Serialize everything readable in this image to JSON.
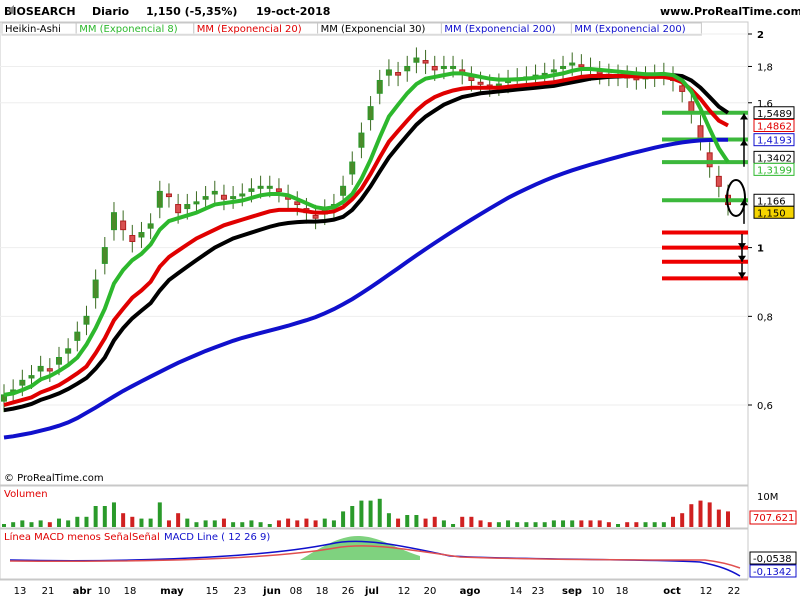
{
  "header": {
    "symbol": "BIOSEARCH",
    "period": "Diario",
    "quote": "1,150 (-5,35%)",
    "date": "19-oct-2018",
    "site": "www.ProRealTime.com"
  },
  "copyright": "© ProRealTime.com",
  "legend": [
    {
      "label": "Heikin-Ashi",
      "color": "#000000"
    },
    {
      "label": "MM (Exponencial 8)",
      "color": "#2db82d"
    },
    {
      "label": "MM (Exponencial 20)",
      "color": "#e00000"
    },
    {
      "label": "MM (Exponencial 30)",
      "color": "#000000"
    },
    {
      "label": "MM (Exponencial 200)",
      "color": "#1010cc"
    },
    {
      "label": "MM (Exponencial 200)",
      "color": "#1010cc"
    }
  ],
  "price_tags": [
    {
      "value": 1.5489,
      "text": "1,5489",
      "color": "#000000",
      "bg": "#ffffff"
    },
    {
      "value": 1.4862,
      "text": "1,4862",
      "color": "#e00000",
      "bg": "#ffffff"
    },
    {
      "value": 1.4193,
      "text": "1,4193",
      "color": "#1010cc",
      "bg": "#ffffff"
    },
    {
      "value": 1.3402,
      "text": "1,3402",
      "color": "#000000",
      "bg": "#ffffff"
    },
    {
      "value": 1.3199,
      "text": "1,3199",
      "color": "#2db82d",
      "bg": "#ffffff"
    },
    {
      "value": 1.166,
      "text": "1,166",
      "color": "#000000",
      "bg": "#ffffff"
    },
    {
      "value": 1.15,
      "text": "1,150",
      "color": "#000000",
      "bg": "#f5d400"
    }
  ],
  "volume": {
    "title": "Volumen",
    "axis_label": "10M",
    "value_tag": "707.621"
  },
  "macd": {
    "label1": "Línea MACD menos Señal",
    "label2": "Señal",
    "label3": "MACD Line ( 12 26 9)",
    "tag1": "-0,0538",
    "tag2": "-0,1342"
  },
  "chart_data": {
    "type": "candlestick",
    "scale": "log",
    "ylim": [
      0.54,
      2.08
    ],
    "y_ticks": [
      {
        "v": 2.0,
        "t": "2",
        "bold": true
      },
      {
        "v": 1.8,
        "t": "1,8",
        "bold": false
      },
      {
        "v": 1.6,
        "t": "1,6",
        "bold": false
      },
      {
        "v": 1.0,
        "t": "1",
        "bold": true
      },
      {
        "v": 0.8,
        "t": "0,8",
        "bold": false
      },
      {
        "v": 0.6,
        "t": "0,6",
        "bold": false
      }
    ],
    "x_ticks": [
      {
        "t": "13",
        "bold": false
      },
      {
        "t": "21",
        "bold": false
      },
      {
        "t": "abr",
        "bold": true
      },
      {
        "t": "10",
        "bold": false
      },
      {
        "t": "18",
        "bold": false
      },
      {
        "t": "may",
        "bold": true
      },
      {
        "t": "15",
        "bold": false
      },
      {
        "t": "23",
        "bold": false
      },
      {
        "t": "jun",
        "bold": true
      },
      {
        "t": "08",
        "bold": false
      },
      {
        "t": "18",
        "bold": false
      },
      {
        "t": "26",
        "bold": false
      },
      {
        "t": "jul",
        "bold": true
      },
      {
        "t": "12",
        "bold": false
      },
      {
        "t": "20",
        "bold": false
      },
      {
        "t": "ago",
        "bold": true
      },
      {
        "t": "14",
        "bold": false
      },
      {
        "t": "23",
        "bold": false
      },
      {
        "t": "sep",
        "bold": true
      },
      {
        "t": "10",
        "bold": false
      },
      {
        "t": "18",
        "bold": false
      },
      {
        "t": "oct",
        "bold": true
      },
      {
        "t": "12",
        "bold": false
      },
      {
        "t": "22",
        "bold": false
      }
    ],
    "close": [
      0.62,
      0.63,
      0.65,
      0.66,
      0.68,
      0.67,
      0.7,
      0.72,
      0.76,
      0.8,
      0.9,
      1.0,
      1.12,
      1.06,
      1.02,
      1.05,
      1.08,
      1.2,
      1.18,
      1.12,
      1.15,
      1.16,
      1.18,
      1.2,
      1.17,
      1.18,
      1.19,
      1.21,
      1.22,
      1.22,
      1.2,
      1.17,
      1.15,
      1.12,
      1.1,
      1.13,
      1.15,
      1.22,
      1.32,
      1.45,
      1.58,
      1.72,
      1.78,
      1.75,
      1.8,
      1.85,
      1.82,
      1.78,
      1.8,
      1.8,
      1.76,
      1.72,
      1.7,
      1.69,
      1.7,
      1.72,
      1.73,
      1.74,
      1.75,
      1.76,
      1.78,
      1.8,
      1.82,
      1.8,
      1.78,
      1.76,
      1.75,
      1.75,
      1.74,
      1.73,
      1.74,
      1.75,
      1.76,
      1.72,
      1.66,
      1.55,
      1.42,
      1.3,
      1.22,
      1.15
    ],
    "ema8": [
      0.62,
      0.623,
      0.63,
      0.638,
      0.652,
      0.659,
      0.67,
      0.683,
      0.7,
      0.73,
      0.77,
      0.82,
      0.89,
      0.93,
      0.96,
      0.98,
      1.01,
      1.06,
      1.09,
      1.1,
      1.11,
      1.12,
      1.135,
      1.15,
      1.155,
      1.16,
      1.165,
      1.175,
      1.185,
      1.19,
      1.19,
      1.185,
      1.17,
      1.155,
      1.14,
      1.135,
      1.14,
      1.16,
      1.19,
      1.25,
      1.33,
      1.43,
      1.53,
      1.59,
      1.65,
      1.7,
      1.73,
      1.74,
      1.75,
      1.76,
      1.76,
      1.75,
      1.74,
      1.73,
      1.725,
      1.725,
      1.727,
      1.73,
      1.735,
      1.74,
      1.75,
      1.76,
      1.775,
      1.785,
      1.785,
      1.78,
      1.775,
      1.77,
      1.765,
      1.76,
      1.755,
      1.755,
      1.757,
      1.75,
      1.72,
      1.66,
      1.57,
      1.47,
      1.38,
      1.32
    ],
    "ema20": [
      0.6,
      0.605,
      0.61,
      0.615,
      0.625,
      0.632,
      0.64,
      0.652,
      0.665,
      0.68,
      0.71,
      0.745,
      0.79,
      0.82,
      0.85,
      0.87,
      0.895,
      0.94,
      0.97,
      0.99,
      1.01,
      1.03,
      1.045,
      1.06,
      1.075,
      1.085,
      1.095,
      1.105,
      1.115,
      1.125,
      1.13,
      1.13,
      1.13,
      1.125,
      1.12,
      1.12,
      1.125,
      1.14,
      1.17,
      1.21,
      1.27,
      1.34,
      1.41,
      1.46,
      1.51,
      1.56,
      1.6,
      1.63,
      1.65,
      1.665,
      1.675,
      1.68,
      1.68,
      1.68,
      1.68,
      1.685,
      1.69,
      1.695,
      1.7,
      1.705,
      1.71,
      1.72,
      1.73,
      1.74,
      1.745,
      1.745,
      1.745,
      1.745,
      1.745,
      1.742,
      1.74,
      1.74,
      1.74,
      1.73,
      1.71,
      1.67,
      1.62,
      1.56,
      1.51,
      1.486
    ],
    "ema30": [
      0.59,
      0.593,
      0.597,
      0.602,
      0.61,
      0.616,
      0.623,
      0.632,
      0.643,
      0.655,
      0.675,
      0.7,
      0.74,
      0.77,
      0.795,
      0.815,
      0.835,
      0.87,
      0.9,
      0.92,
      0.94,
      0.96,
      0.98,
      1.0,
      1.015,
      1.03,
      1.04,
      1.05,
      1.06,
      1.07,
      1.078,
      1.083,
      1.086,
      1.088,
      1.088,
      1.09,
      1.095,
      1.105,
      1.13,
      1.17,
      1.22,
      1.28,
      1.34,
      1.39,
      1.44,
      1.49,
      1.53,
      1.56,
      1.59,
      1.61,
      1.63,
      1.64,
      1.65,
      1.655,
      1.66,
      1.665,
      1.67,
      1.675,
      1.68,
      1.685,
      1.69,
      1.7,
      1.71,
      1.72,
      1.73,
      1.735,
      1.74,
      1.742,
      1.745,
      1.746,
      1.748,
      1.75,
      1.752,
      1.75,
      1.745,
      1.72,
      1.68,
      1.63,
      1.58,
      1.549
    ],
    "ema200": [
      0.54,
      0.542,
      0.545,
      0.548,
      0.552,
      0.556,
      0.561,
      0.567,
      0.575,
      0.585,
      0.595,
      0.606,
      0.617,
      0.628,
      0.638,
      0.648,
      0.658,
      0.668,
      0.678,
      0.688,
      0.697,
      0.706,
      0.715,
      0.723,
      0.731,
      0.739,
      0.746,
      0.752,
      0.758,
      0.764,
      0.77,
      0.776,
      0.783,
      0.79,
      0.798,
      0.808,
      0.819,
      0.832,
      0.846,
      0.862,
      0.879,
      0.897,
      0.916,
      0.935,
      0.955,
      0.975,
      0.995,
      1.015,
      1.035,
      1.055,
      1.075,
      1.095,
      1.115,
      1.135,
      1.155,
      1.175,
      1.193,
      1.21,
      1.227,
      1.243,
      1.258,
      1.272,
      1.285,
      1.297,
      1.309,
      1.32,
      1.331,
      1.342,
      1.353,
      1.363,
      1.373,
      1.383,
      1.392,
      1.4,
      1.407,
      1.412,
      1.416,
      1.418,
      1.419,
      1.419
    ],
    "support_lines": [
      1.5489,
      1.42,
      1.3199,
      1.166
    ],
    "resistance_lines": [
      1.05,
      1.0,
      0.955,
      0.905
    ]
  }
}
